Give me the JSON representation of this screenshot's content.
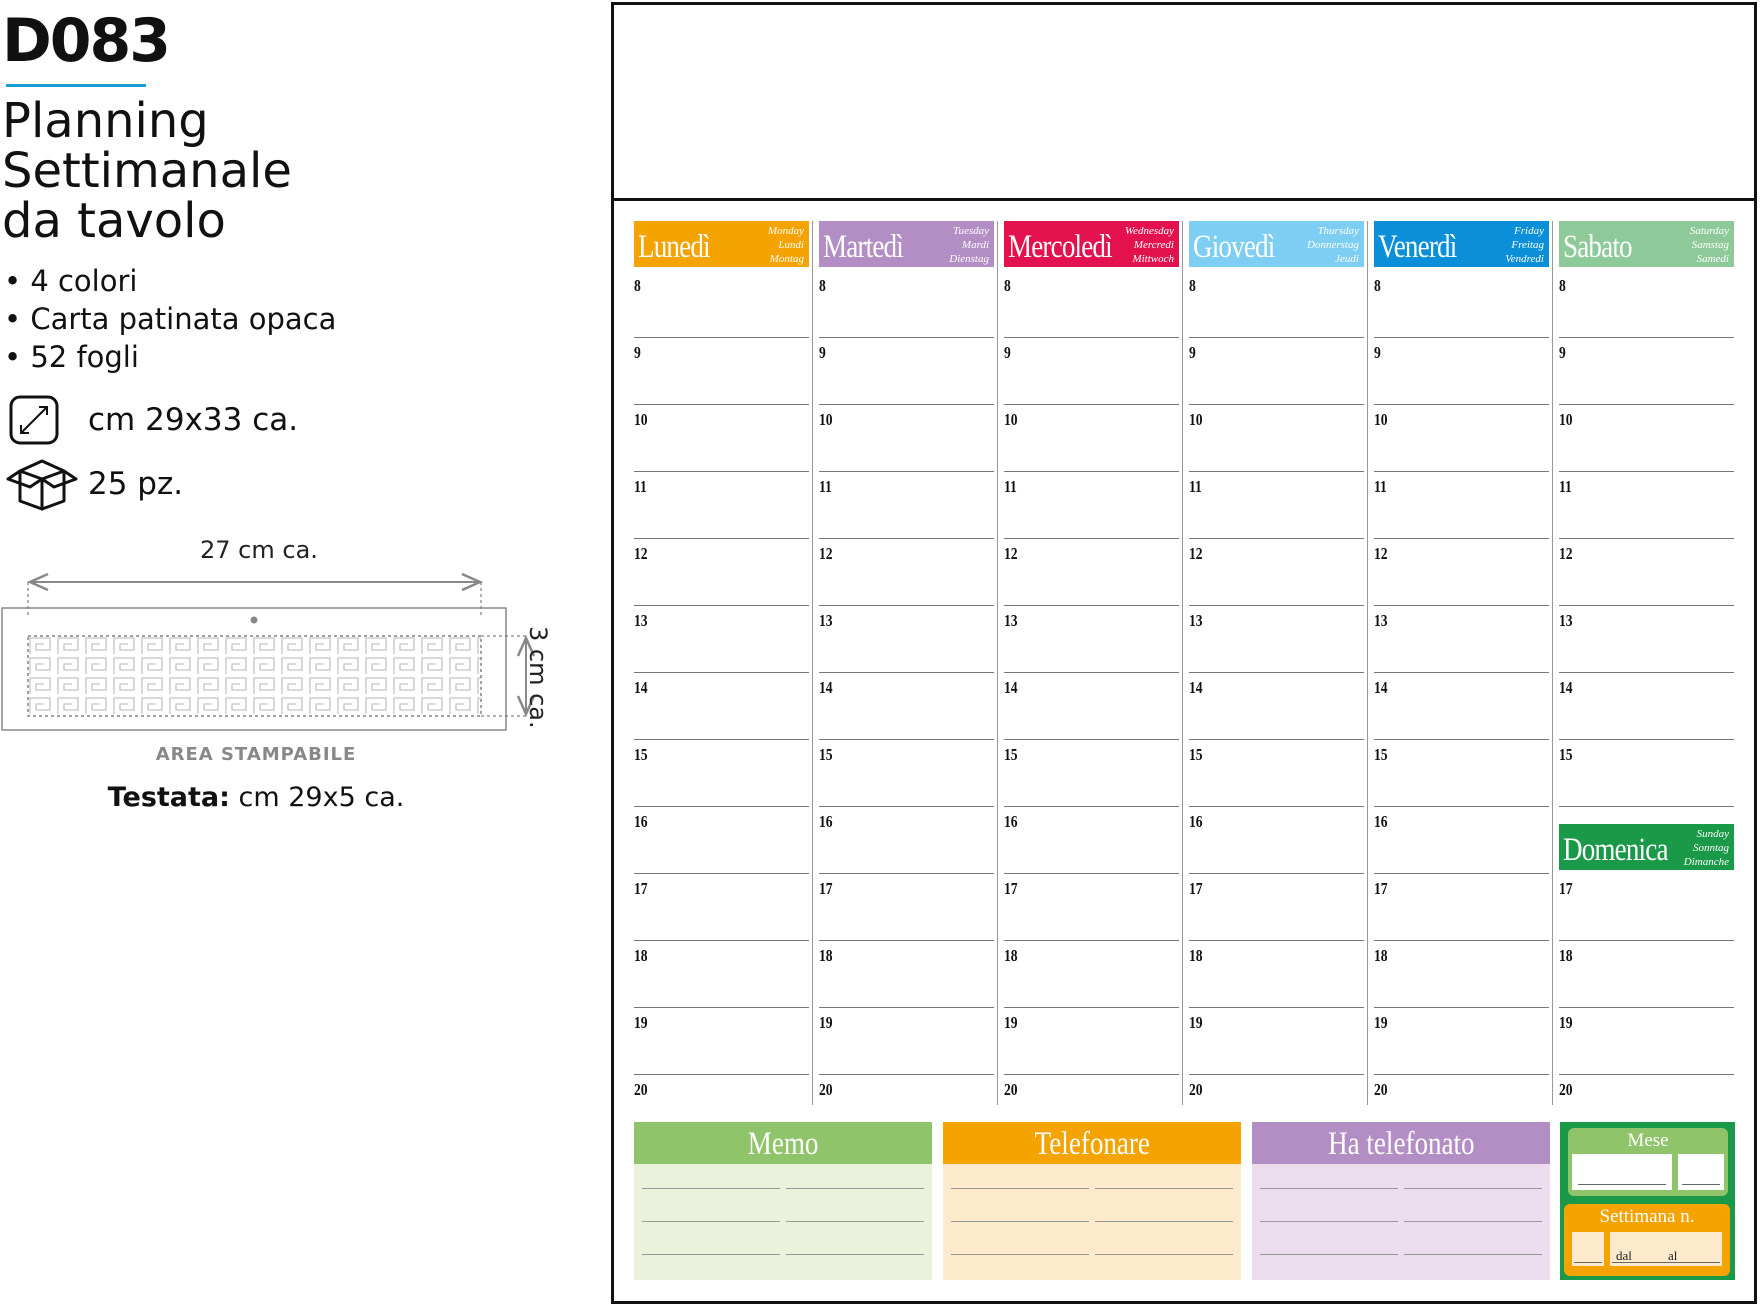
{
  "product": {
    "code": "D083",
    "title_lines": [
      "Planning",
      "Settimanale",
      "da tavolo"
    ],
    "features": [
      "• 4 colori",
      "• Carta patinata opaca",
      "• 52 fogli"
    ],
    "size_text": "cm 29x33 ca.",
    "pack_text": "25 pz.",
    "size_icon": "diagonal-arrow-icon",
    "pack_icon": "open-box-icon"
  },
  "printable_area": {
    "width_label": "27 cm ca.",
    "height_label": "3 cm ca.",
    "area_label": "AREA STAMPABILE",
    "header_label": "Testata:",
    "header_value": " cm 29x5 ca."
  },
  "planner": {
    "days": [
      {
        "name": "Lunedì",
        "translations": [
          "Monday",
          "Lundi",
          "Montag"
        ],
        "color": "#f5a300"
      },
      {
        "name": "Martedì",
        "translations": [
          "Tuesday",
          "Mardi",
          "Dienstag"
        ],
        "color": "#b38ec4"
      },
      {
        "name": "Mercoledì",
        "translations": [
          "Wednesday",
          "Mercredi",
          "Mittwoch"
        ],
        "color": "#e3124f"
      },
      {
        "name": "Giovedì",
        "translations": [
          "Thursday",
          "Donnerstag",
          "Jeudi"
        ],
        "color": "#7ecdf2"
      },
      {
        "name": "Venerdì",
        "translations": [
          "Friday",
          "Freitag",
          "Vendredi"
        ],
        "color": "#0a8fd8"
      },
      {
        "name": "Sabato",
        "translations": [
          "Saturday",
          "Samstag",
          "Samedi"
        ],
        "color": "#8ec99a"
      }
    ],
    "sunday": {
      "name": "Domenica",
      "translations": [
        "Sunday",
        "Sonntag",
        "Dimanche"
      ],
      "color": "#1a9a48"
    },
    "hours": [
      "8",
      "9",
      "10",
      "11",
      "12",
      "13",
      "14",
      "15",
      "16",
      "17",
      "18",
      "19",
      "20"
    ],
    "saturday_hours": [
      "8",
      "9",
      "10",
      "11",
      "12",
      "13",
      "14",
      "15"
    ],
    "sunday_hours": [
      "17",
      "18",
      "19",
      "20"
    ],
    "boxes": [
      {
        "title": "Memo",
        "color": "#8fc46a",
        "fill": "#eaf2dc"
      },
      {
        "title": "Telefonare",
        "color": "#f5a300",
        "fill": "#fde9cc"
      },
      {
        "title": "Ha telefonato",
        "color": "#b38ec4",
        "fill": "#ebdcee"
      }
    ],
    "month_box": {
      "mese_label": "Mese",
      "settimana_label": "Settimana n.",
      "dal_label": "dal",
      "al_label": "al",
      "mese_color": "#8fc46a",
      "settimana_color": "#f5a300",
      "field_fill": "#fde9cc"
    }
  }
}
